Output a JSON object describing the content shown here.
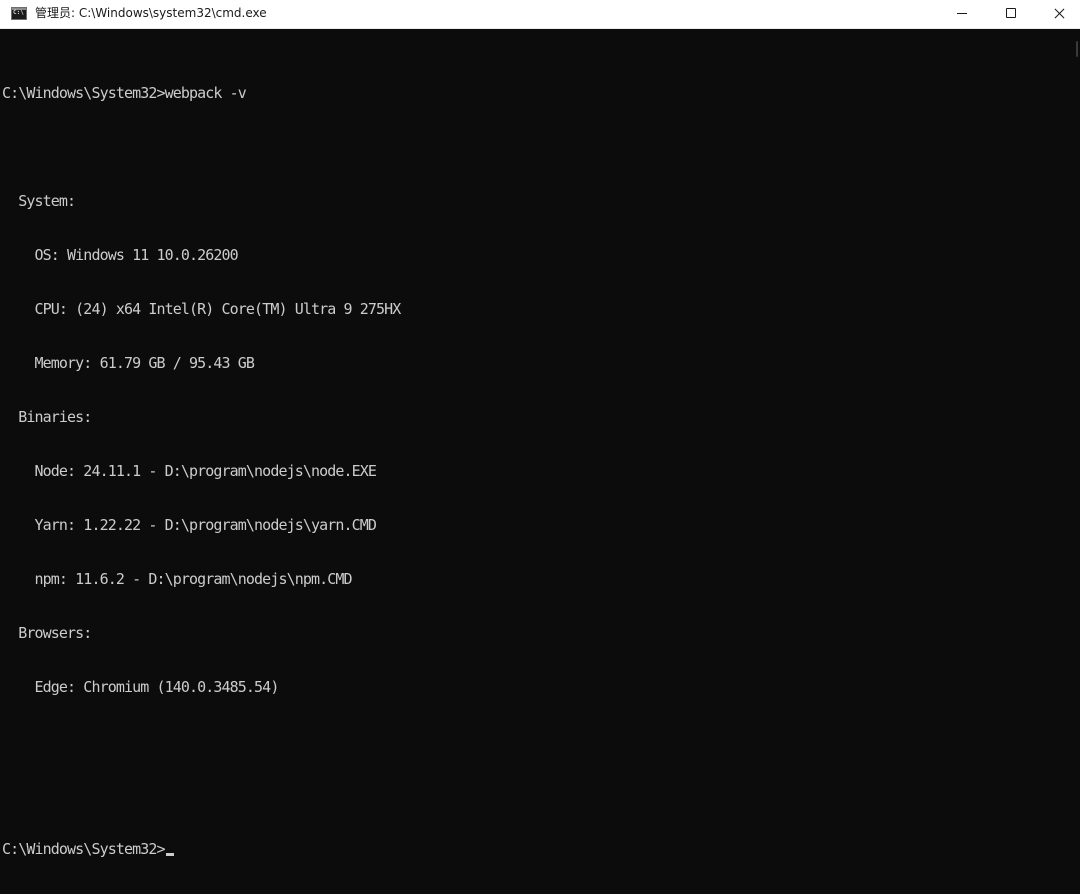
{
  "window": {
    "title": "管理员:  C:\\Windows\\system32\\cmd.exe",
    "icon": "cmd-app-icon",
    "icon_label": "C:\\"
  },
  "controls": {
    "minimize_icon": "minimize-icon",
    "maximize_icon": "maximize-icon",
    "close_icon": "close-icon"
  },
  "console": {
    "lines": [
      "C:\\Windows\\System32>webpack -v",
      "",
      "  System:",
      "    OS: Windows 11 10.0.26200",
      "    CPU: (24) x64 Intel(R) Core(TM) Ultra 9 275HX",
      "    Memory: 61.79 GB / 95.43 GB",
      "  Binaries:",
      "    Node: 24.11.1 - D:\\program\\nodejs\\node.EXE",
      "    Yarn: 1.22.22 - D:\\program\\nodejs\\yarn.CMD",
      "    npm: 11.6.2 - D:\\program\\nodejs\\npm.CMD",
      "  Browsers:",
      "    Edge: Chromium (140.0.3485.54)",
      "",
      "",
      "C:\\Windows\\System32>"
    ]
  },
  "colors": {
    "console_bg": "#0c0c0c",
    "console_fg": "#cccccc",
    "titlebar_bg": "#ffffff"
  }
}
